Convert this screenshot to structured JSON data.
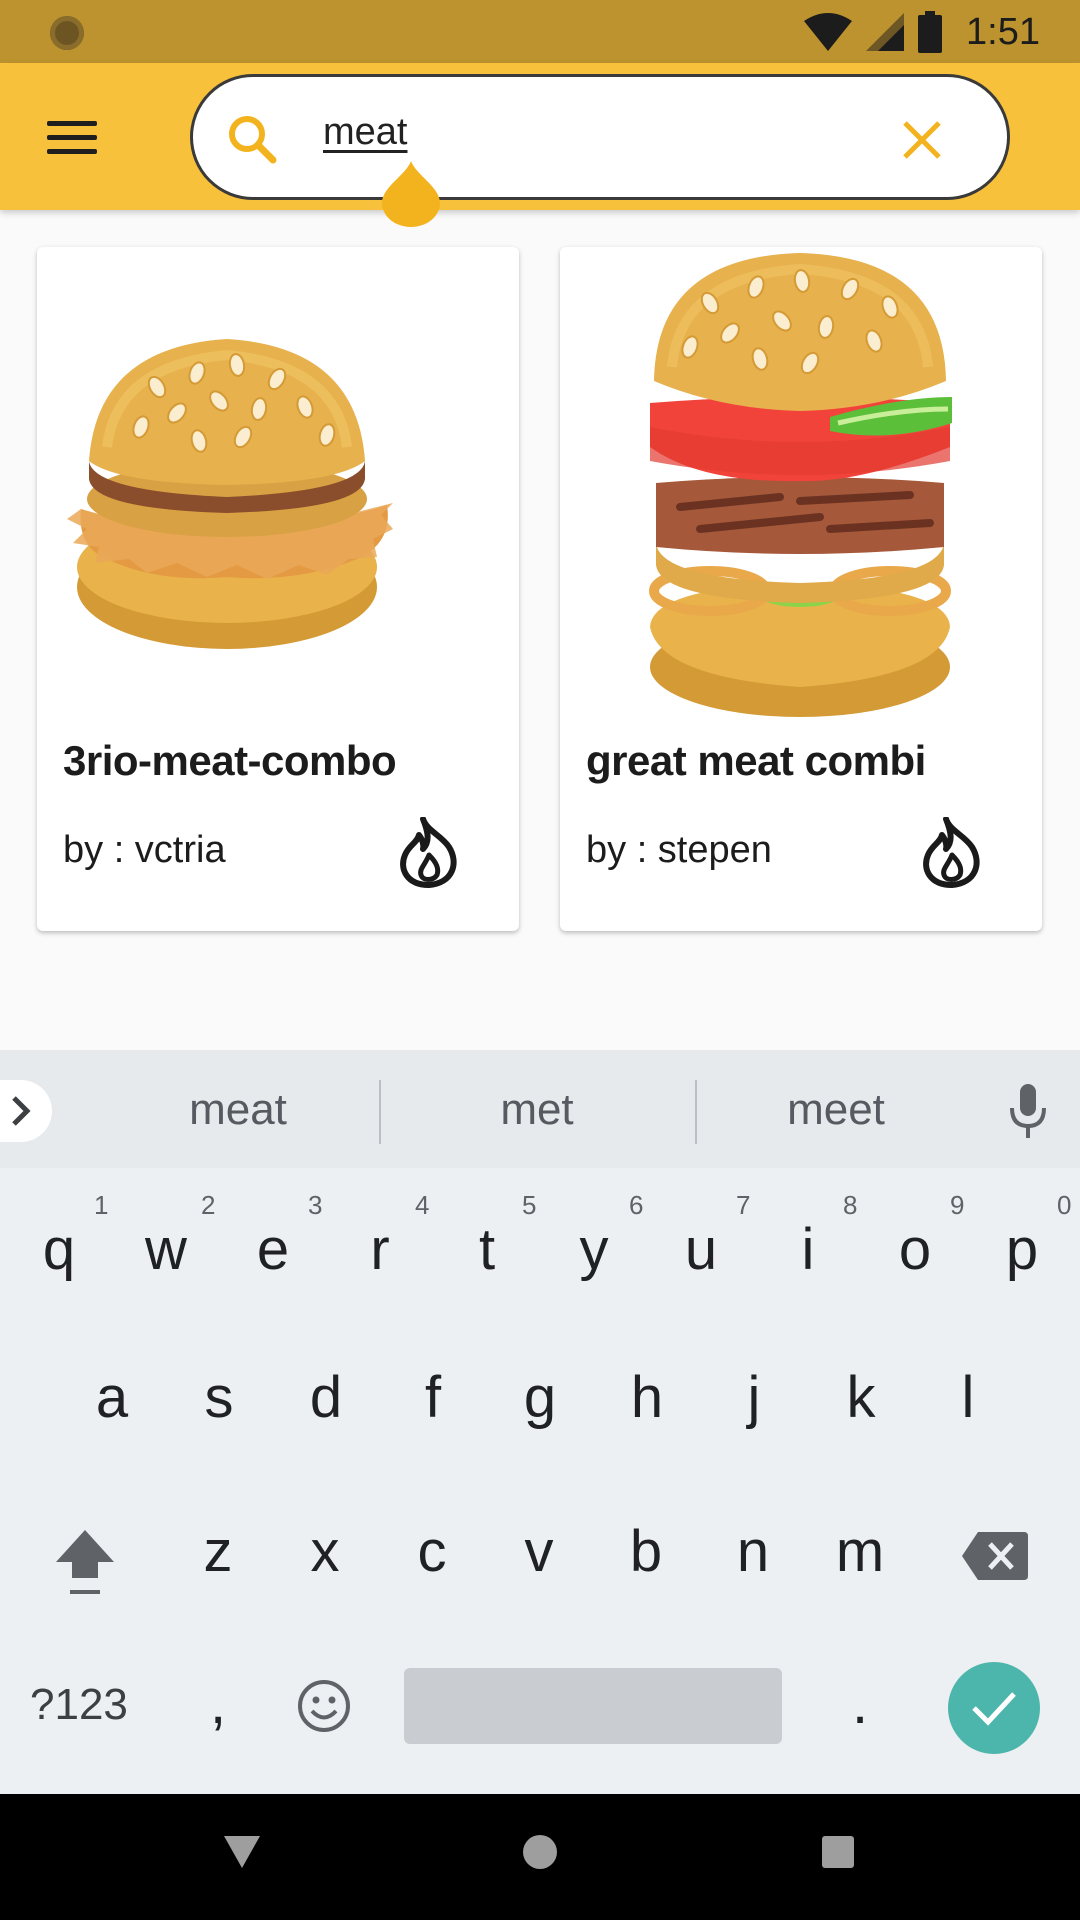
{
  "status_bar": {
    "time": "1:51"
  },
  "search": {
    "query": "meat"
  },
  "results": [
    {
      "title": "3rio-meat-combo",
      "author": "by : vctria"
    },
    {
      "title": "great meat combi",
      "author": "by : stepen"
    }
  ],
  "keyboard": {
    "suggestions": [
      "meat",
      "met",
      "meet"
    ],
    "row1": [
      {
        "key": "q",
        "hint": "1"
      },
      {
        "key": "w",
        "hint": "2"
      },
      {
        "key": "e",
        "hint": "3"
      },
      {
        "key": "r",
        "hint": "4"
      },
      {
        "key": "t",
        "hint": "5"
      },
      {
        "key": "y",
        "hint": "6"
      },
      {
        "key": "u",
        "hint": "7"
      },
      {
        "key": "i",
        "hint": "8"
      },
      {
        "key": "o",
        "hint": "9"
      },
      {
        "key": "p",
        "hint": "0"
      }
    ],
    "row2": [
      "a",
      "s",
      "d",
      "f",
      "g",
      "h",
      "j",
      "k",
      "l"
    ],
    "row3": [
      "z",
      "x",
      "c",
      "v",
      "b",
      "n",
      "m"
    ],
    "symbols_label": "?123",
    "comma": ",",
    "period": "."
  },
  "colors": {
    "status_bar": "#bc932e",
    "app_bar": "#f8c13b",
    "accent": "#f8c13b",
    "enter_button": "#4db6ac"
  }
}
